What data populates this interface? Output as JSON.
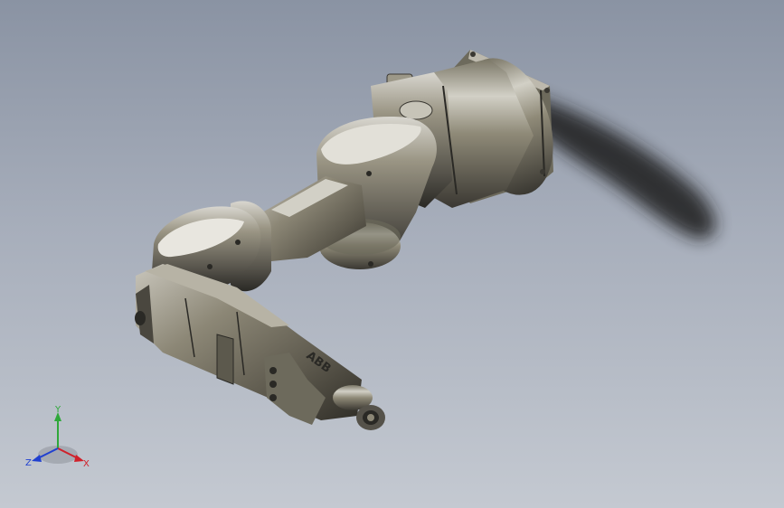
{
  "viewport": {
    "background_top": "#8a93a3",
    "background_bottom": "#c4c9d1"
  },
  "model": {
    "name_on_part": "ABB",
    "body_color": "#8c8776",
    "highlight_color": "#e8e6df",
    "shadow_color": "#2a2925"
  },
  "triad": {
    "x_label": "X",
    "y_label": "Y",
    "z_label": "Z",
    "x_color": "#d0202a",
    "y_color": "#2fa83a",
    "z_color": "#2040d0"
  }
}
